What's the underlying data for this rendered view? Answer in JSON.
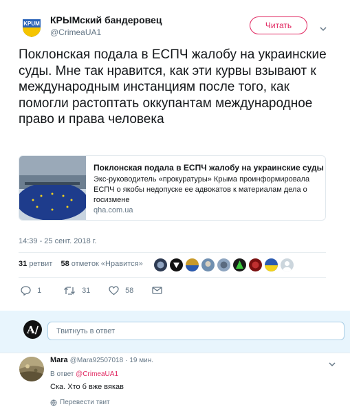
{
  "tweet": {
    "display_name": "КРЫМский бандеровец",
    "handle": "@CrimeaUA1",
    "follow_label": "Читать",
    "text": "Поклонская подала в ЕСПЧ жалобу на украинские суды. Мне так нравится, как эти курвы взывают к международным инстанциям после того, как помогли растоптать оккупантам международное право и права человека",
    "timestamp": "14:39 - 25 сент. 2018 г."
  },
  "card": {
    "title": "Поклонская подала в ЕСПЧ жалобу на украинские суды",
    "description": "Экс-руководитель «прокуратуры» Крыма проинформировала ЕСПЧ о якобы недопуске ее адвокатов к материалам дела о госизмене",
    "domain": "qha.com.ua"
  },
  "stats": {
    "retweets_count": "31",
    "retweets_label": "ретвит",
    "likes_count": "58",
    "likes_label": "отметок «Нравится»"
  },
  "actions": {
    "reply_count": "1",
    "retweet_count": "31",
    "like_count": "58"
  },
  "reply_box": {
    "placeholder": "Твитнуть в ответ"
  },
  "reply": {
    "name": "Mara",
    "handle": "@Mara92507018",
    "time": "· 19 мин.",
    "in_reply_prefix": "В ответ",
    "in_reply_handle": "@CrimeaUA1",
    "text": "Ска. Хто б вже вякав",
    "translate_label": "Перевести твит"
  },
  "colors": {
    "accent": "#e0245e",
    "secondary_text": "#657786",
    "reply_bg": "#e8f5fd"
  }
}
